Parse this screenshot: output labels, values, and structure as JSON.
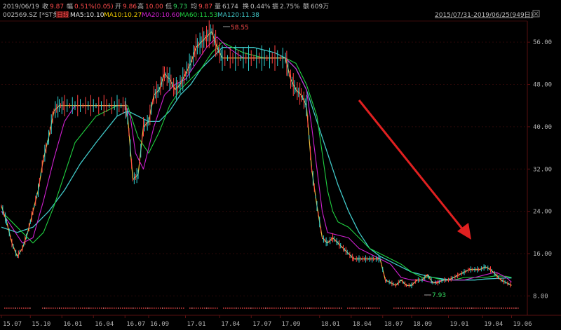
{
  "header": {
    "date": "2019/06/19",
    "close_label": "收",
    "close_value": "9.87",
    "change_label": "幅",
    "change_value": "0.51%(0.05)",
    "open_label": "开",
    "open_value": "9.86",
    "high_label": "高",
    "high_value": "10.00",
    "low_label": "低",
    "low_value": "9.73",
    "avg_label": "均",
    "avg_value": "9.87",
    "volume_label": "量",
    "volume_value": "6174",
    "turnover_label": "换",
    "turnover_value": "0.44%",
    "amplitude_label": "振",
    "amplitude_value": "2.75%",
    "amount_label": "额",
    "amount_value": "609万",
    "range": "2015/07/31-2019/06/25(949日)"
  },
  "legend": {
    "stock": "002569.SZ [*ST步森]",
    "mode": "日线",
    "ma5": "MA5:10.10",
    "ma10": "MA10:10.27",
    "ma20": "MA20:10.60",
    "ma60": "MA60:11.53",
    "ma120": "MA120:11.38"
  },
  "annotations": {
    "high_marker": "58.55",
    "low_marker": "7.93"
  },
  "colors": {
    "background": "#000000",
    "price": "#f0c040",
    "ma5": "#e8e8e8",
    "ma10": "#f5d000",
    "ma20": "#d020d0",
    "ma60": "#20d040",
    "ma120": "#40c8c8",
    "arrow": "#e02020",
    "grid": "#3a0a0a"
  },
  "chart_data": {
    "type": "line",
    "title": "",
    "ylabel": "",
    "xlabel": "",
    "ylim": [
      5,
      60
    ],
    "xlim": [
      0,
      100
    ],
    "y_ticks": [
      "56.00",
      "48.00",
      "40.00",
      "32.00",
      "24.00",
      "16.00",
      "8.00"
    ],
    "y_tick_values": [
      56,
      48,
      40,
      32,
      24,
      16,
      8
    ],
    "x_ticks": [
      "15.07",
      "15.10",
      "16.01",
      "16.04",
      "16.07",
      "16.09",
      "17.01",
      "17.04",
      "17.07",
      "17.09",
      "18.01",
      "18.04",
      "18.07",
      "18.09",
      "19.01",
      "19.04",
      "19.06"
    ],
    "x_tick_positions": [
      0,
      5.5,
      11.5,
      17.5,
      23.5,
      28,
      35,
      41.5,
      47.5,
      53,
      60.5,
      66.5,
      72.5,
      78,
      85,
      91.5,
      97
    ],
    "series": [
      {
        "key": "price",
        "x": [
          0,
          1,
          2,
          3,
          4,
          5,
          6,
          7,
          8,
          9,
          10,
          11,
          12,
          14,
          16,
          18,
          20,
          22,
          23.5,
          24,
          25,
          26,
          27,
          28,
          29,
          30,
          31,
          32,
          33,
          34,
          35,
          36,
          37,
          38,
          39,
          40,
          41,
          42,
          44,
          46,
          48,
          50,
          52,
          54,
          55,
          56,
          57,
          58,
          59,
          60,
          61,
          62,
          63,
          64,
          65,
          66,
          67,
          68,
          69,
          70,
          71,
          72,
          73,
          74,
          75,
          76,
          77,
          78,
          79,
          80,
          81,
          82,
          83,
          84,
          85,
          86,
          87,
          88,
          89,
          90,
          91,
          92,
          93,
          94,
          95,
          96,
          97
        ],
        "values": [
          25,
          22,
          18,
          15.5,
          17,
          20,
          24,
          28,
          34,
          38,
          43,
          44,
          44,
          44,
          44,
          44,
          44,
          44,
          44,
          42,
          30,
          31,
          40,
          41,
          46,
          47,
          50,
          49,
          47,
          48,
          50,
          52,
          55,
          56,
          57,
          58,
          55,
          53,
          53,
          53,
          53,
          53,
          53,
          53,
          49,
          47,
          46,
          44,
          32,
          25,
          19,
          18,
          19,
          18,
          17,
          16,
          15,
          15,
          15,
          15,
          15,
          15,
          11,
          10.5,
          10,
          11,
          10,
          10,
          11,
          11,
          12,
          10.5,
          10.5,
          11,
          11,
          11.5,
          12,
          12.5,
          13,
          13,
          13,
          13.5,
          13,
          12,
          11,
          10.5,
          10
        ]
      },
      {
        "key": "ma20",
        "x": [
          0,
          2,
          4,
          6,
          8,
          10,
          12,
          14,
          18,
          22,
          23.5,
          24.5,
          25.5,
          27,
          29,
          31,
          33,
          35,
          37,
          39,
          41,
          43,
          46,
          50,
          54,
          56,
          58,
          59,
          60,
          61,
          62,
          64,
          66,
          68,
          70,
          72,
          74,
          76,
          78,
          80,
          82,
          84,
          86,
          88,
          90,
          92,
          94,
          96,
          97
        ],
        "values": [
          24,
          21,
          18,
          19,
          26,
          34,
          41,
          44,
          44,
          44,
          44,
          42,
          35,
          32,
          40,
          46,
          48,
          49,
          52,
          55,
          57,
          55,
          53,
          53,
          53,
          51,
          47,
          40,
          32,
          24,
          20,
          19.5,
          19,
          17,
          16,
          15,
          14,
          11.5,
          11,
          11,
          10.5,
          11,
          11,
          11,
          11.5,
          12,
          12.5,
          11.5,
          10.6
        ]
      },
      {
        "key": "ma60",
        "x": [
          0,
          2,
          4,
          6,
          8,
          10,
          12,
          14,
          18,
          22,
          24,
          26,
          28,
          30,
          32,
          34,
          36,
          38,
          40,
          42,
          44,
          46,
          50,
          54,
          56,
          58,
          60,
          61,
          62,
          63,
          64,
          66,
          68,
          70,
          72,
          74,
          76,
          78,
          80,
          82,
          84,
          86,
          88,
          90,
          92,
          94,
          96,
          97
        ],
        "values": [
          24,
          22,
          20,
          18,
          20,
          25,
          31,
          37,
          42,
          44,
          44,
          38,
          35,
          39,
          44,
          47,
          49,
          51,
          54,
          56,
          55,
          54,
          53,
          53,
          52,
          48,
          42,
          35,
          28,
          24,
          22,
          21,
          19,
          17,
          16,
          15,
          14,
          12.5,
          11.5,
          11.5,
          11,
          11,
          11.5,
          11.5,
          11.5,
          11.8,
          11.7,
          11.5
        ]
      },
      {
        "key": "ma120",
        "x": [
          0,
          3,
          6,
          9,
          12,
          15,
          18,
          22,
          24,
          26,
          28,
          30,
          32,
          34,
          36,
          38,
          40,
          42,
          44,
          46,
          48,
          50,
          52,
          54,
          56,
          58,
          60,
          62,
          64,
          66,
          68,
          70,
          72,
          74,
          76,
          78,
          80,
          82,
          84,
          86,
          88,
          90,
          92,
          94,
          96,
          97
        ],
        "values": [
          21,
          20,
          21,
          24,
          28,
          33,
          37,
          42,
          43,
          42,
          41,
          41,
          43,
          46,
          48,
          51,
          53,
          55,
          55,
          55,
          55,
          54.5,
          54,
          53,
          51,
          47,
          41,
          35,
          29,
          24,
          20,
          17,
          15.5,
          14.5,
          13.5,
          12.5,
          12,
          11.5,
          11.2,
          11,
          11,
          11,
          11.2,
          11.3,
          11.4,
          11.4
        ]
      }
    ]
  }
}
